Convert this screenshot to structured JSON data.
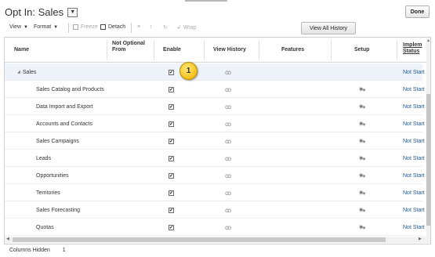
{
  "page": {
    "title": "Opt In: Sales",
    "done_label": "Done"
  },
  "toolbar": {
    "view_label": "View",
    "format_label": "Format",
    "freeze_label": "Freeze",
    "detach_label": "Detach",
    "wrap_label": "Wrap",
    "view_all_history_label": "View All History"
  },
  "table": {
    "headers": {
      "name": "Name",
      "not_optional_from": "Not Optional From",
      "enable": "Enable",
      "view_history": "View History",
      "features": "Features",
      "setup": "Setup",
      "implementation_status": "Implem Status"
    },
    "rows": [
      {
        "name": "Sales",
        "level": 0,
        "enabled": true,
        "has_setup": false,
        "status": "Not Start"
      },
      {
        "name": "Sales Catalog and Products",
        "level": 1,
        "enabled": true,
        "has_setup": true,
        "status": "Not Start"
      },
      {
        "name": "Data Import and Export",
        "level": 1,
        "enabled": true,
        "has_setup": true,
        "status": "Not Start"
      },
      {
        "name": "Accounts and Contacts",
        "level": 1,
        "enabled": true,
        "has_setup": true,
        "status": "Not Start"
      },
      {
        "name": "Sales Campaigns",
        "level": 1,
        "enabled": true,
        "has_setup": true,
        "status": "Not Start"
      },
      {
        "name": "Leads",
        "level": 1,
        "enabled": true,
        "has_setup": true,
        "status": "Not Start"
      },
      {
        "name": "Opportunities",
        "level": 1,
        "enabled": true,
        "has_setup": true,
        "status": "Not Start"
      },
      {
        "name": "Territories",
        "level": 1,
        "enabled": true,
        "has_setup": true,
        "status": "Not Start"
      },
      {
        "name": "Sales Forecasting",
        "level": 1,
        "enabled": true,
        "has_setup": true,
        "status": "Not Start"
      },
      {
        "name": "Quotas",
        "level": 1,
        "enabled": true,
        "has_setup": true,
        "status": "Not Start"
      }
    ]
  },
  "callout": {
    "number": "1"
  },
  "footer": {
    "columns_hidden_label": "Columns Hidden",
    "columns_hidden_count": "1"
  },
  "icons": {
    "dropdown": "chevron-down-icon",
    "view_history": "glasses-icon",
    "setup": "gear-icon",
    "expander": "triangle-down-icon"
  },
  "colors": {
    "link": "#1e5a96",
    "callout": "#f3c21a",
    "selected_row": "#eef3fa"
  }
}
